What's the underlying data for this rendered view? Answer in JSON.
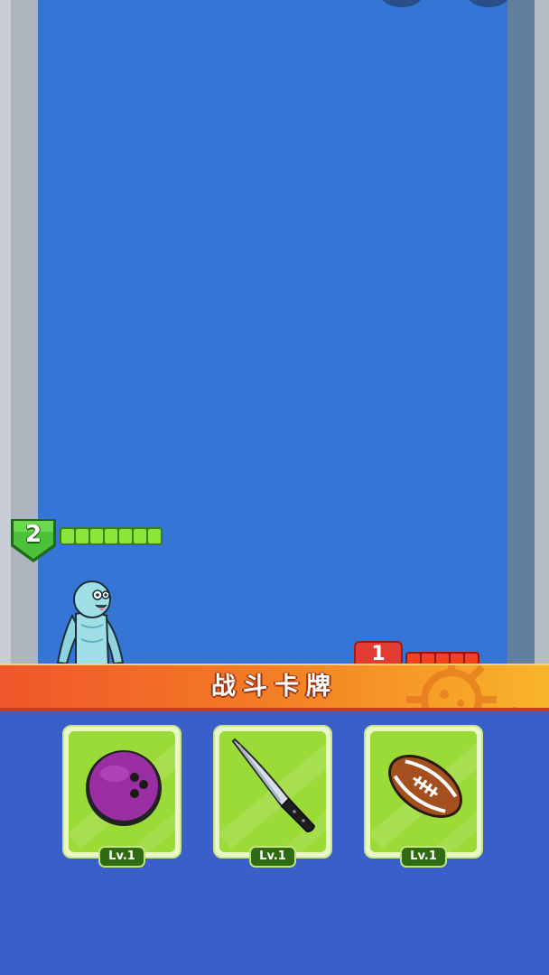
{
  "player": {
    "level": "2",
    "hp_segments": 7
  },
  "enemy": {
    "level": "1",
    "hp_segments": 5
  },
  "banner": {
    "title": "战斗卡牌"
  },
  "cards": [
    {
      "icon": "bowling-ball-icon",
      "level": "Lv.1"
    },
    {
      "icon": "knife-icon",
      "level": "Lv.1"
    },
    {
      "icon": "football-icon",
      "level": "Lv.1"
    }
  ],
  "colors": {
    "arena": "#3575d6",
    "panel": "#3a5fc8",
    "card": "#9bdb38",
    "banner_start": "#f0562a",
    "banner_end": "#f8b52a"
  }
}
